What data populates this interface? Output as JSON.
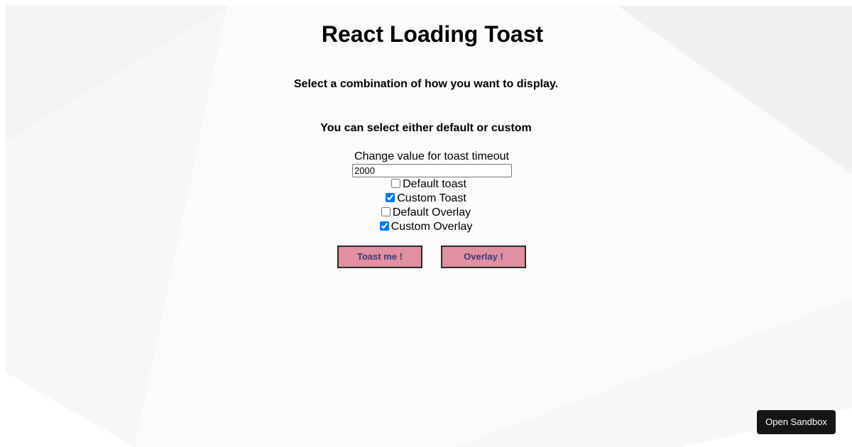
{
  "page": {
    "title": "React Loading Toast",
    "subtitle_1": "Select a combination of how you want to display.",
    "subtitle_2": "You can select either default or custom"
  },
  "form": {
    "timeout_label": "Change value for toast timeout",
    "timeout_value": "2000",
    "checkboxes": [
      {
        "label": "Default toast",
        "checked": false
      },
      {
        "label": "Custom Toast",
        "checked": true
      },
      {
        "label": "Default Overlay",
        "checked": false
      },
      {
        "label": "Custom Overlay",
        "checked": true
      }
    ]
  },
  "buttons": {
    "toast_label": "Toast me !",
    "overlay_label": "Overlay !"
  },
  "sandbox": {
    "label": "Open Sandbox"
  },
  "colors": {
    "button_fill": "#e090a0",
    "button_text": "#3a3a7a",
    "sandbox_fill": "#151515",
    "background_shapes": "#f4f4f4"
  }
}
